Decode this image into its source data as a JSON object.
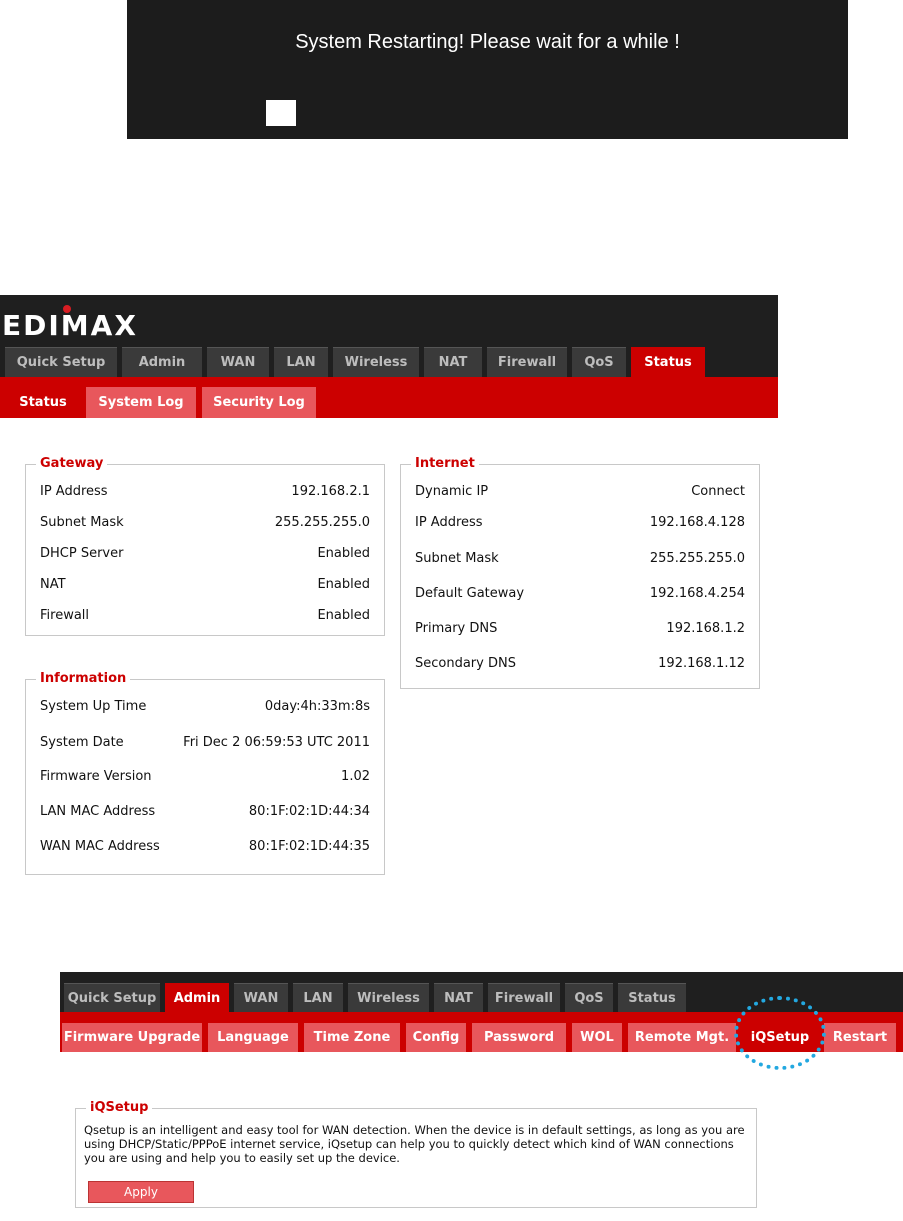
{
  "restart": {
    "message": "System Restarting! Please wait for a while !"
  },
  "status_page": {
    "logo": "EDIMAX",
    "main_tabs": [
      "Quick Setup",
      "Admin",
      "WAN",
      "LAN",
      "Wireless",
      "NAT",
      "Firewall",
      "QoS",
      "Status"
    ],
    "active_main_tab": "Status",
    "sub_tabs": [
      "Status",
      "System Log",
      "Security Log"
    ],
    "active_sub_tab": "Status",
    "gateway": {
      "title": "Gateway",
      "rows": [
        {
          "label": "IP Address",
          "value": "192.168.2.1"
        },
        {
          "label": "Subnet Mask",
          "value": "255.255.255.0"
        },
        {
          "label": "DHCP Server",
          "value": "Enabled"
        },
        {
          "label": "NAT",
          "value": "Enabled"
        },
        {
          "label": "Firewall",
          "value": "Enabled"
        }
      ]
    },
    "information": {
      "title": "Information",
      "rows": [
        {
          "label": "System Up Time",
          "value": "0day:4h:33m:8s"
        },
        {
          "label": "System Date",
          "value": "Fri Dec 2 06:59:53 UTC 2011"
        },
        {
          "label": "Firmware Version",
          "value": "1.02"
        },
        {
          "label": "LAN MAC Address",
          "value": "80:1F:02:1D:44:34"
        },
        {
          "label": "WAN MAC Address",
          "value": "80:1F:02:1D:44:35"
        }
      ]
    },
    "internet": {
      "title": "Internet",
      "rows": [
        {
          "label": "Dynamic IP",
          "value": "Connect"
        },
        {
          "label": "IP Address",
          "value": "192.168.4.128"
        },
        {
          "label": "Subnet Mask",
          "value": "255.255.255.0"
        },
        {
          "label": "Default Gateway",
          "value": "192.168.4.254"
        },
        {
          "label": "Primary DNS",
          "value": "192.168.1.2"
        },
        {
          "label": "Secondary DNS",
          "value": "192.168.1.12"
        }
      ]
    }
  },
  "admin_page": {
    "main_tabs": [
      "Quick Setup",
      "Admin",
      "WAN",
      "LAN",
      "Wireless",
      "NAT",
      "Firewall",
      "QoS",
      "Status"
    ],
    "active_main_tab": "Admin",
    "sub_tabs": [
      "Firmware Upgrade",
      "Language",
      "Time Zone",
      "Config",
      "Password",
      "WOL",
      "Remote Mgt.",
      "iQSetup",
      "Restart"
    ],
    "active_sub_tab": "iQSetup",
    "iqsetup": {
      "title": "iQSetup",
      "description": "Qsetup is an intelligent and easy tool for WAN detection. When the device is in default settings, as long as you are using DHCP/Static/PPPoE internet service, iQsetup can help you to quickly detect which kind of WAN connections you are using and help you to easily set up the device.",
      "apply_label": "Apply"
    }
  },
  "colors": {
    "brand_red": "#cc0000",
    "subtab_pink": "#e8575c",
    "header_black": "#1f1f1f",
    "highlight_blue": "#23a8e0"
  }
}
